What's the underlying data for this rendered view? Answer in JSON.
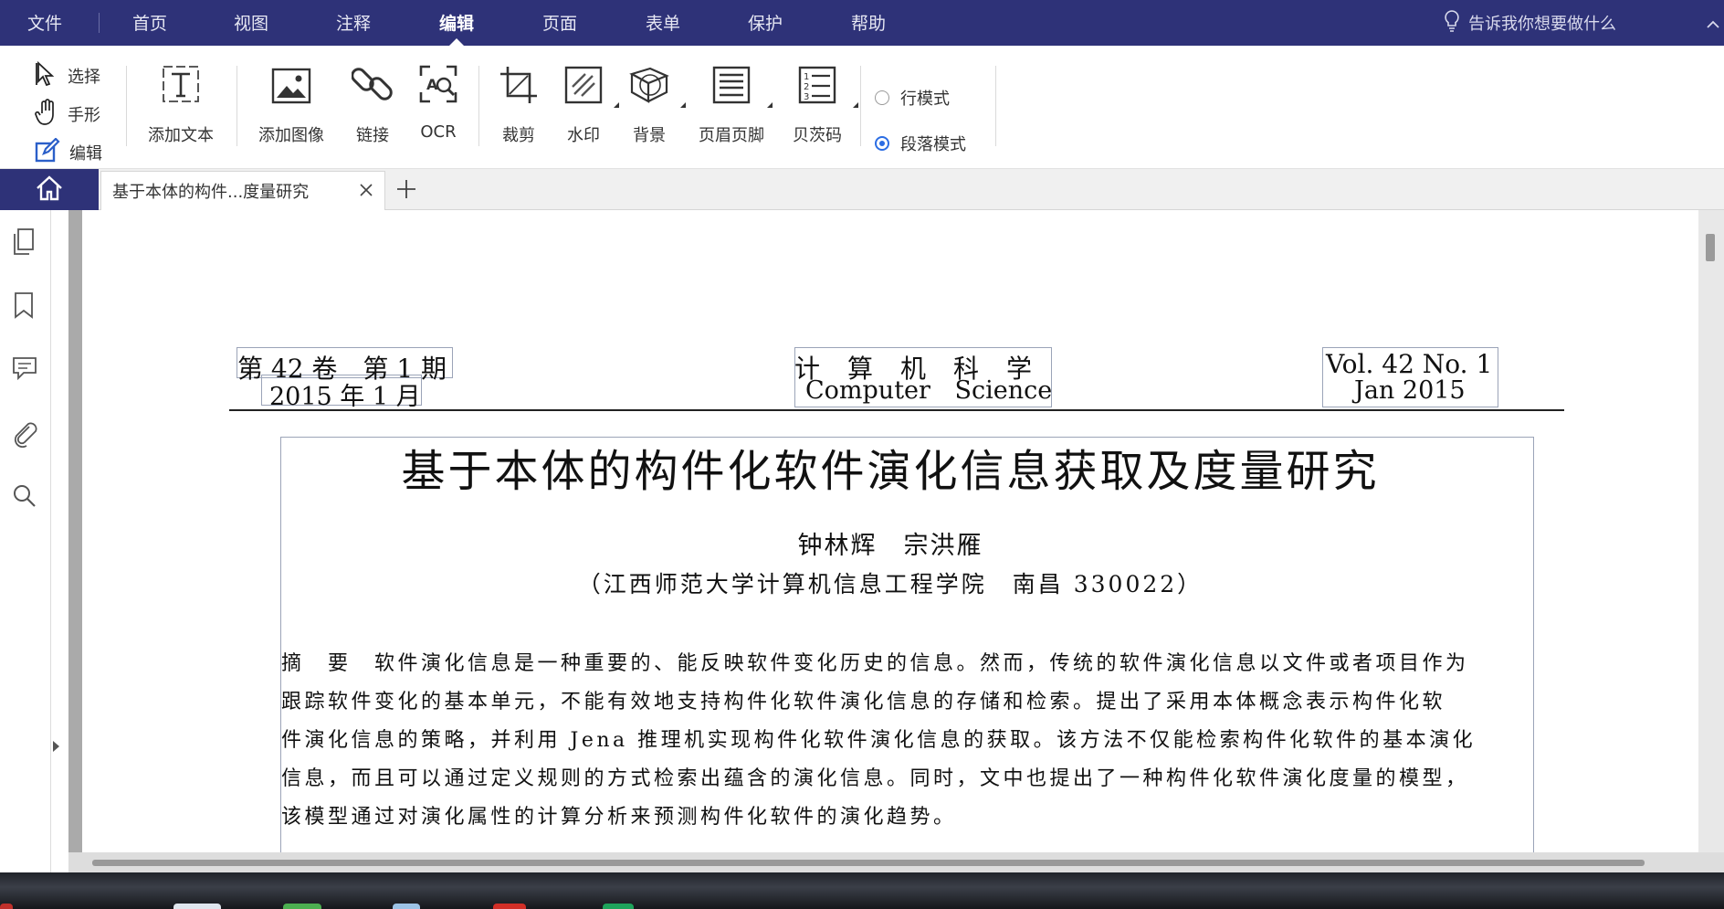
{
  "menu": {
    "items": [
      {
        "label": "文件",
        "key": "file"
      },
      {
        "label": "首页",
        "key": "home"
      },
      {
        "label": "视图",
        "key": "view"
      },
      {
        "label": "注释",
        "key": "comment"
      },
      {
        "label": "编辑",
        "key": "edit"
      },
      {
        "label": "页面",
        "key": "page"
      },
      {
        "label": "表单",
        "key": "form"
      },
      {
        "label": "保护",
        "key": "protect"
      },
      {
        "label": "帮助",
        "key": "help"
      }
    ],
    "active": "编辑",
    "tell_me": "告诉我你想要做什么"
  },
  "ribbon": {
    "modes": {
      "select": "选择",
      "hand": "手形",
      "edit": "编辑"
    },
    "tools": {
      "add_text": "添加文本",
      "add_image": "添加图像",
      "link": "链接",
      "ocr": "OCR",
      "crop": "裁剪",
      "watermark": "水印",
      "background": "背景",
      "header_footer": "页眉页脚",
      "bates": "贝茨码"
    },
    "edit_mode": {
      "line": "行模式",
      "paragraph": "段落模式",
      "selected": "段落模式"
    }
  },
  "tabs": {
    "document_tab": "基于本体的构件...度量研究"
  },
  "document": {
    "header_left_1": "第 42 卷　第 1 期",
    "header_left_2": "2015 年 1 月",
    "header_mid_1": "计算机科学",
    "header_mid_2": "Computer Science",
    "header_right_1": "Vol. 42 No. 1",
    "header_right_2": "Jan 2015",
    "title": "基于本体的构件化软件演化信息获取及度量研究",
    "authors": "钟林辉　宗洪雁",
    "affiliation": "（江西师范大学计算机信息工程学院　南昌 330022）",
    "abstract_lines": [
      "摘　要　软件演化信息是一种重要的、能反映软件变化历史的信息。然而，传统的软件演化信息以文件或者项目作为",
      "跟踪软件变化的基本单元，不能有效地支持构件化软件演化信息的存储和检索。提出了采用本体概念表示构件化软",
      "件演化信息的策略，并利用 Jena 推理机实现构件化软件演化信息的获取。该方法不仅能检索构件化软件的基本演化",
      "信息，而且可以通过定义规则的方式检索出蕴含的演化信息。同时，文中也提出了一种构件化软件演化度量的模型，",
      "该模型通过对演化属性的计算分析来预测构件化软件的演化趋势。"
    ]
  },
  "colors": {
    "menubar": "#2e3278",
    "accent": "#2b6de3",
    "icon_blue": "#2b5fc9"
  }
}
